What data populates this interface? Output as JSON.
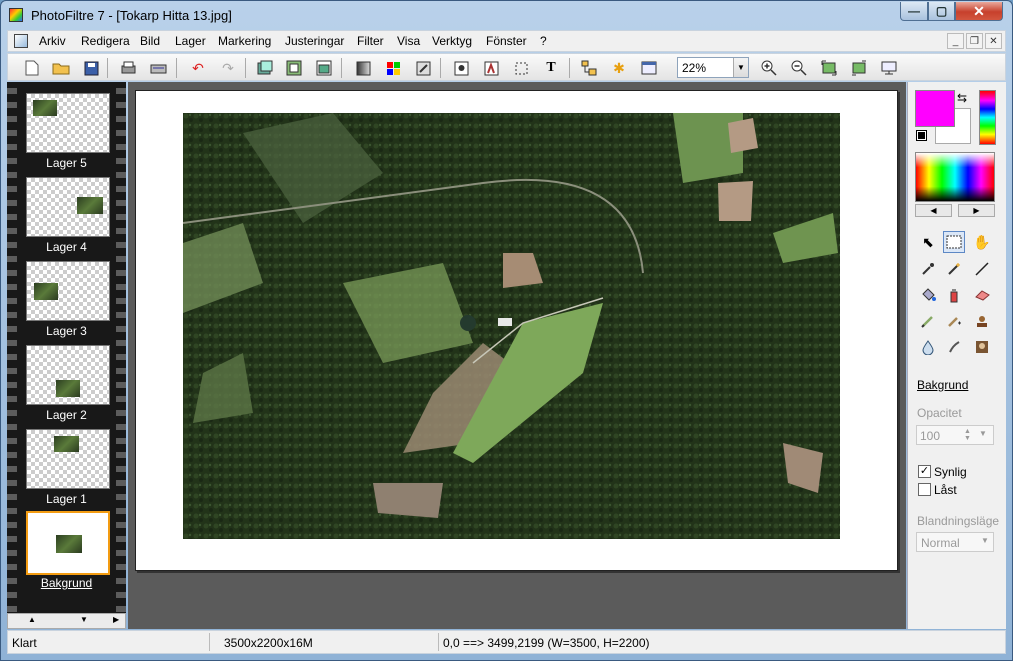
{
  "window": {
    "title": "PhotoFiltre 7 - [Tokarp Hitta 13.jpg]"
  },
  "menu": {
    "items": [
      "Arkiv",
      "Redigera",
      "Bild",
      "Lager",
      "Markering",
      "Justeringar",
      "Filter",
      "Visa",
      "Verktyg",
      "Fönster",
      "?"
    ]
  },
  "toolbar": {
    "zoom": "22%"
  },
  "layers": {
    "items": [
      {
        "label": "Lager 5"
      },
      {
        "label": "Lager 4"
      },
      {
        "label": "Lager 3"
      },
      {
        "label": "Lager 2"
      },
      {
        "label": "Lager 1"
      },
      {
        "label": "Bakgrund"
      }
    ],
    "selected": "Bakgrund"
  },
  "right_panel": {
    "foreground_color": "#ff00ff",
    "background_color": "#ffffff",
    "layer_name": "Bakgrund",
    "opacity_label": "Opacitet",
    "opacity_value": "100",
    "visible_label": "Synlig",
    "visible_checked": true,
    "locked_label": "Låst",
    "locked_checked": false,
    "blend_label": "Blandningsläge",
    "blend_value": "Normal"
  },
  "status": {
    "state": "Klart",
    "image_info": "3500x2200x16M",
    "coords": "0,0 ==> 3499,2199 (W=3500, H=2200)"
  }
}
